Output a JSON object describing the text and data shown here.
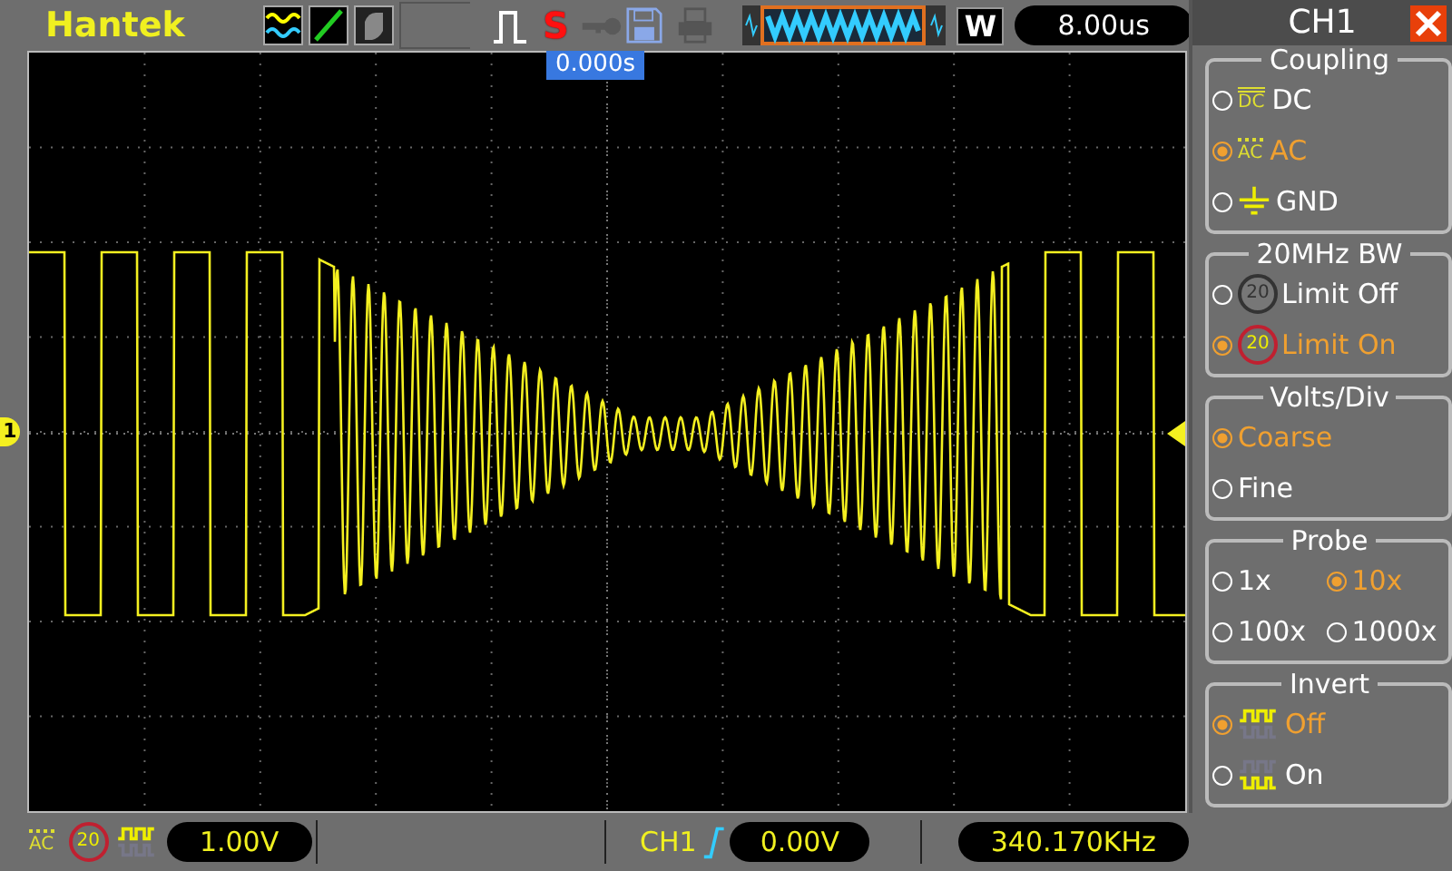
{
  "top_bar": {
    "brand": "Hantek",
    "save_mode_letter": "S",
    "zoom_letter": "W",
    "timebase": "8.00us"
  },
  "screen": {
    "trigger_time": "0.000s",
    "channel_marker": "1"
  },
  "channel_panel": {
    "title": "CH1",
    "groups": [
      {
        "title": "Coupling",
        "kind": "rows",
        "options": [
          {
            "label": "DC",
            "kind": "dc",
            "icon_text": "DC",
            "selected": false
          },
          {
            "label": "AC",
            "kind": "ac",
            "icon_text": "AC",
            "selected": true
          },
          {
            "label": "GND",
            "kind": "gnd",
            "selected": false
          }
        ]
      },
      {
        "title": "20MHz BW",
        "kind": "rows",
        "options": [
          {
            "label": "Limit Off",
            "kind": "bw",
            "icon_text": "20",
            "selected": false
          },
          {
            "label": "Limit On",
            "kind": "bw",
            "icon_text": "20",
            "selected": true
          }
        ]
      },
      {
        "title": "Volts/Div",
        "kind": "rows",
        "options": [
          {
            "label": "Coarse",
            "selected": true
          },
          {
            "label": "Fine",
            "selected": false
          }
        ]
      },
      {
        "title": "Probe",
        "kind": "grid",
        "options": [
          {
            "label": "1x",
            "selected": false
          },
          {
            "label": "10x",
            "selected": true
          },
          {
            "label": "100x",
            "selected": false
          },
          {
            "label": "1000x",
            "selected": false
          }
        ]
      },
      {
        "title": "Invert",
        "kind": "rows",
        "options": [
          {
            "label": "Off",
            "kind": "normal",
            "selected": true
          },
          {
            "label": "On",
            "kind": "inverted",
            "selected": false
          }
        ]
      }
    ]
  },
  "status_bar": {
    "coupling_text": "AC",
    "bw_text": "20",
    "volts_div": "1.00V",
    "trigger_source": "CH1",
    "trigger_level": "0.00V",
    "frequency": "340.170KHz"
  }
}
